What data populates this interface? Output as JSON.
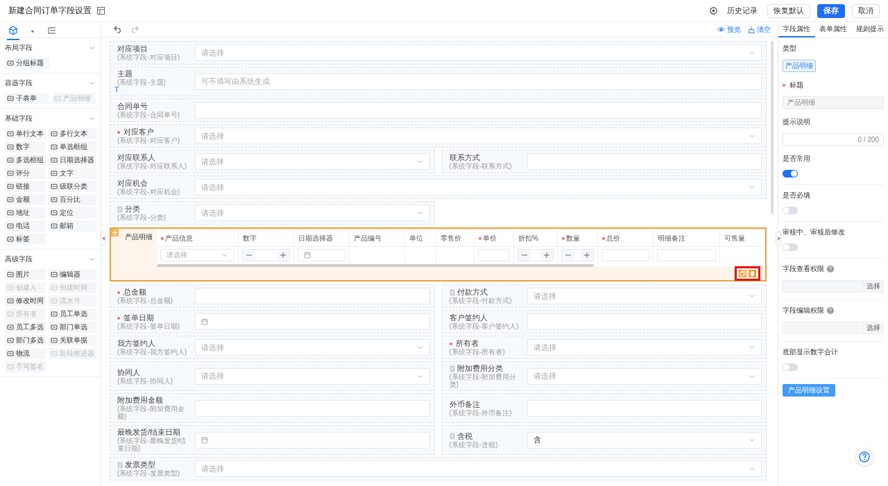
{
  "header": {
    "title": "新建合同订单字段设置",
    "actions": [
      {
        "label": "历史记录",
        "kind": "link"
      },
      {
        "label": "恢复默认",
        "kind": "default"
      },
      {
        "label": "保存",
        "kind": "primary"
      },
      {
        "label": "取消",
        "kind": "default"
      }
    ]
  },
  "sidebar": {
    "tabs": [
      {
        "selected": true
      },
      {
        "selected": false
      },
      {
        "selected": false
      }
    ],
    "sections": [
      {
        "title": "布局字段",
        "expanded": true,
        "items": [
          {
            "label": "分组标题",
            "disabled": false
          }
        ]
      },
      {
        "title": "容器字段",
        "expanded": true,
        "items": [
          {
            "label": "子表单",
            "disabled": false
          },
          {
            "label": "产品明细",
            "disabled": true
          }
        ]
      },
      {
        "title": "基础字段",
        "expanded": true,
        "items": [
          {
            "label": "单行文本",
            "disabled": false
          },
          {
            "label": "多行文本",
            "disabled": false
          },
          {
            "label": "数字",
            "disabled": false
          },
          {
            "label": "单选框组",
            "disabled": false
          },
          {
            "label": "多选框组",
            "disabled": false
          },
          {
            "label": "日期选择器",
            "disabled": false
          },
          {
            "label": "评分",
            "disabled": false
          },
          {
            "label": "文字",
            "disabled": false
          },
          {
            "label": "链接",
            "disabled": false
          },
          {
            "label": "级联分类",
            "disabled": false
          },
          {
            "label": "金额",
            "disabled": false
          },
          {
            "label": "百分比",
            "disabled": false
          },
          {
            "label": "地址",
            "disabled": false
          },
          {
            "label": "定位",
            "disabled": false
          },
          {
            "label": "电话",
            "disabled": false
          },
          {
            "label": "邮箱",
            "disabled": false
          },
          {
            "label": "标签",
            "disabled": false
          }
        ]
      },
      {
        "title": "高级字段",
        "expanded": true,
        "items": [
          {
            "label": "图片",
            "disabled": false
          },
          {
            "label": "编辑器",
            "disabled": false
          },
          {
            "label": "创建人",
            "disabled": true
          },
          {
            "label": "创建时间",
            "disabled": true
          },
          {
            "label": "修改时间",
            "disabled": false
          },
          {
            "label": "流水号",
            "disabled": true
          },
          {
            "label": "所有者",
            "disabled": true
          },
          {
            "label": "员工单选",
            "disabled": false
          },
          {
            "label": "员工多选",
            "disabled": false
          },
          {
            "label": "部门单选",
            "disabled": false
          },
          {
            "label": "部门多选",
            "disabled": false
          },
          {
            "label": "关联单据",
            "disabled": false
          },
          {
            "label": "物流",
            "disabled": false
          },
          {
            "label": "阶段推进器",
            "disabled": true
          },
          {
            "label": "手写签名",
            "disabled": true
          }
        ]
      }
    ]
  },
  "toolbar": {
    "actions": [
      {
        "label": "预览",
        "kind": "preview"
      },
      {
        "label": "清空",
        "kind": "clear"
      }
    ]
  },
  "form": {
    "rows": [
      {
        "kind": "fields",
        "fields": [
          {
            "label": "对应项目",
            "hint": "(系统字段-对应项目)",
            "required": false,
            "locked": false,
            "kind": "select",
            "placeholder": "请选择"
          }
        ]
      },
      {
        "kind": "fields",
        "fields": [
          {
            "label": "主题",
            "hint": "(系统字段-主题)",
            "required": false,
            "locked": false,
            "badge": "T",
            "kind": "input",
            "placeholder": "可不填写由系统生成"
          }
        ]
      },
      {
        "kind": "fields",
        "fields": [
          {
            "label": "合同单号",
            "hint": "(系统字段-合同单号)",
            "required": false,
            "locked": false,
            "kind": "input"
          }
        ]
      },
      {
        "kind": "fields",
        "fields": [
          {
            "label": "对应客户",
            "hint": "(系统字段-对应客户)",
            "required": true,
            "locked": false,
            "kind": "select",
            "placeholder": "请选择"
          }
        ]
      },
      {
        "kind": "fields",
        "fields": [
          {
            "label": "对应联系人",
            "hint": "(系统字段-对应联系人)",
            "required": false,
            "locked": false,
            "kind": "select",
            "placeholder": "请选择"
          },
          {
            "label": "联系方式",
            "hint": "(系统字段-联系方式)",
            "required": false,
            "locked": false,
            "kind": "input"
          }
        ]
      },
      {
        "kind": "fields",
        "fields": [
          {
            "label": "对应机会",
            "hint": "(系统字段-对应机会)",
            "required": false,
            "locked": false,
            "kind": "select",
            "placeholder": "请选择"
          }
        ]
      },
      {
        "kind": "fields",
        "half": true,
        "fields": [
          {
            "label": "分类",
            "hint": "(系统字段-分类)",
            "required": false,
            "locked": true,
            "kind": "select",
            "placeholder": "请选择"
          }
        ]
      },
      {
        "kind": "table",
        "label": "产品明细",
        "selected": true,
        "actions_highlighted": true,
        "columns": [
          {
            "label": "产品信息",
            "required": true,
            "kind": "select",
            "placeholder": "请选择"
          },
          {
            "label": "数字",
            "required": false,
            "kind": "stepper"
          },
          {
            "label": "日期选择器",
            "required": false,
            "kind": "date"
          },
          {
            "label": "产品编号",
            "required": false,
            "kind": "none"
          },
          {
            "label": "单位",
            "required": false,
            "kind": "none"
          },
          {
            "label": "零售价",
            "required": false,
            "kind": "none"
          },
          {
            "label": "单价",
            "required": true,
            "kind": "input"
          },
          {
            "label": "折扣%",
            "required": false,
            "kind": "stepper"
          },
          {
            "label": "数量",
            "required": true,
            "kind": "stepper"
          },
          {
            "label": "总价",
            "required": true,
            "kind": "input"
          },
          {
            "label": "明细备注",
            "required": false,
            "kind": "input"
          },
          {
            "label": "可售量",
            "required": false,
            "kind": "none"
          }
        ]
      },
      {
        "kind": "fields",
        "fields": [
          {
            "label": "总金额",
            "hint": "(系统字段-总金额)",
            "required": true,
            "locked": false,
            "kind": "input"
          },
          {
            "label": "付款方式",
            "hint": "(系统字段-付款方式)",
            "required": false,
            "locked": true,
            "kind": "select",
            "placeholder": "请选择"
          }
        ]
      },
      {
        "kind": "fields",
        "fields": [
          {
            "label": "签单日期",
            "hint": "(系统字段-签单日期)",
            "required": true,
            "locked": false,
            "kind": "date"
          },
          {
            "label": "客户签约人",
            "hint": "(系统字段-客户签约人)",
            "required": false,
            "locked": false,
            "kind": "input"
          }
        ]
      },
      {
        "kind": "fields",
        "fields": [
          {
            "label": "我方签约人",
            "hint": "(系统字段-我方签约人)",
            "required": false,
            "locked": false,
            "kind": "select",
            "placeholder": "请选择"
          },
          {
            "label": "所有者",
            "hint": "(系统字段-所有者)",
            "required": true,
            "locked": false,
            "kind": "select",
            "placeholder": "请选择"
          }
        ]
      },
      {
        "kind": "fields",
        "fields": [
          {
            "label": "协同人",
            "hint": "(系统字段-协同人)",
            "required": false,
            "locked": false,
            "kind": "select",
            "placeholder": "请选择"
          },
          {
            "label": "附加费用分类",
            "hint": "(系统字段-附加费用分类)",
            "required": false,
            "locked": true,
            "kind": "select",
            "placeholder": "请选择"
          }
        ]
      },
      {
        "kind": "fields",
        "fields": [
          {
            "label": "附加费用金额",
            "hint": "(系统字段-附加费用金额)",
            "required": false,
            "locked": false,
            "kind": "input"
          },
          {
            "label": "外币备注",
            "hint": "(系统字段-外币备注)",
            "required": false,
            "locked": false,
            "kind": "input"
          }
        ]
      },
      {
        "kind": "fields",
        "fields": [
          {
            "label": "最晚发货/结束日期",
            "hint": "(系统字段-最晚发货/结束日期)",
            "required": false,
            "locked": false,
            "kind": "date"
          },
          {
            "label": "含税",
            "hint": "(系统字段-含税)",
            "required": false,
            "locked": true,
            "kind": "select",
            "value": "含"
          }
        ]
      },
      {
        "kind": "fields",
        "fields": [
          {
            "label": "发票类型",
            "hint": "(系统字段-发票类型)",
            "required": false,
            "locked": true,
            "kind": "select",
            "placeholder": "请选择"
          }
        ]
      }
    ]
  },
  "properties": {
    "tabs": [
      {
        "label": "字段属性",
        "selected": true
      },
      {
        "label": "表单属性",
        "selected": false
      },
      {
        "label": "规则提示",
        "selected": false
      }
    ],
    "items": [
      {
        "kind": "tag",
        "label": "类型",
        "value": "产品明细"
      },
      {
        "kind": "text",
        "label": "标题",
        "required": true,
        "disabled": true,
        "value": "产品明细"
      },
      {
        "kind": "textarea",
        "label": "提示说明",
        "counter": "0 / 200"
      },
      {
        "kind": "toggle",
        "label": "是否常用",
        "on": true
      },
      {
        "kind": "toggle",
        "label": "是否必填",
        "on": false
      },
      {
        "kind": "toggle",
        "label": "审核中、审核后修改",
        "on": false
      },
      {
        "kind": "picker",
        "label": "字段查看权限",
        "help": true,
        "button": "选择"
      },
      {
        "kind": "picker",
        "label": "字段编辑权限",
        "help": true,
        "button": "选择"
      },
      {
        "kind": "toggle",
        "label": "底部显示数字合计",
        "on": false
      },
      {
        "kind": "button",
        "label": "产品明细设置"
      }
    ]
  }
}
